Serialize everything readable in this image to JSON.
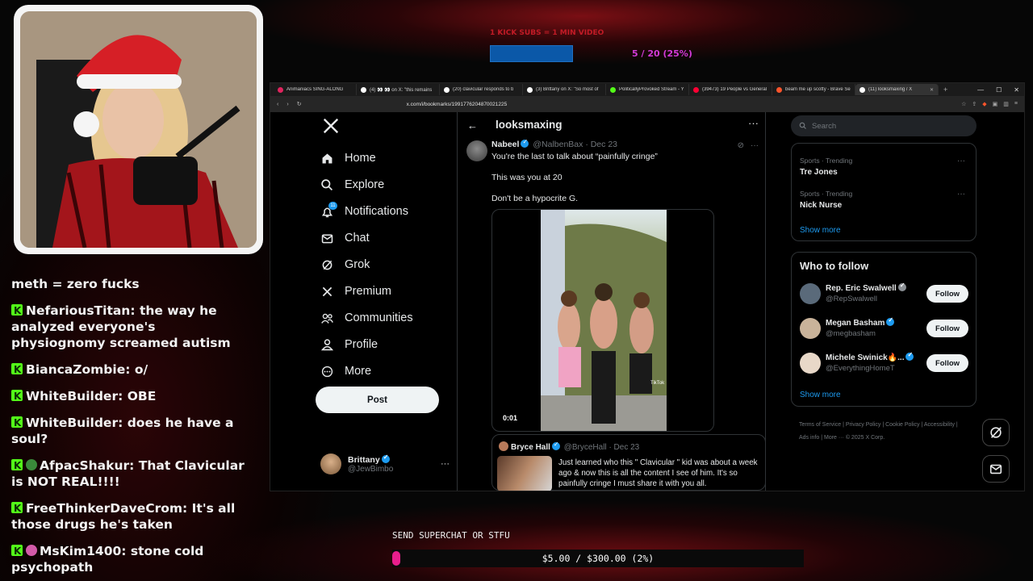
{
  "overlay_top": {
    "goal_label": "1 KICK SUBS = 1 MIN VIDEO",
    "goal_progress_text": "5 / 20 (25%)",
    "goal_progress_fraction": 0.25
  },
  "chat": {
    "messages": [
      {
        "user": "",
        "text": "meth = zero fucks",
        "badge": false,
        "emoji": ""
      },
      {
        "user": "NefariousTitan",
        "text": "the way he analyzed everyone's physiognomy screamed autism",
        "badge": true,
        "emoji": ""
      },
      {
        "user": "BiancaZombie",
        "text": "o/",
        "badge": true,
        "emoji": ""
      },
      {
        "user": "WhiteBuilder",
        "text": "OBE",
        "badge": true,
        "emoji": ""
      },
      {
        "user": "WhiteBuilder",
        "text": "does he have a soul?",
        "badge": true,
        "emoji": ""
      },
      {
        "user": "AfpacShakur",
        "text": "That Clavicular is NOT REAL!!!!",
        "badge": true,
        "emoji": "green"
      },
      {
        "user": "FreeThinkerDaveCrom",
        "text": "It's all those drugs he's taken",
        "badge": true,
        "emoji": ""
      },
      {
        "user": "MsKim1400",
        "text": "stone cold psychopath",
        "badge": true,
        "emoji": "pink"
      }
    ]
  },
  "browser": {
    "tabs": [
      {
        "title": "Animaniacs SING-ALONG",
        "color": "#e0245e",
        "active": false
      },
      {
        "title": "(4) 👀 👀 on X: \"this remains",
        "color": "#ffffff",
        "active": false
      },
      {
        "title": "(20) clavicular responds to b",
        "color": "#ffffff",
        "active": false
      },
      {
        "title": "(3) Brittany on X: \"So most of",
        "color": "#ffffff",
        "active": false
      },
      {
        "title": "PoliticallyProvoked Stream - Y",
        "color": "#53fc18",
        "active": false
      },
      {
        "title": "(39473) 19 People vs General",
        "color": "#ff0033",
        "active": false
      },
      {
        "title": "beam me up scotty - Brave Se",
        "color": "#fb542b",
        "active": false
      },
      {
        "title": "(11) looksmaxing / X",
        "color": "#ffffff",
        "active": true
      }
    ],
    "new_tab": "+",
    "url": "x.com/i/bookmarks/1991776204870021225"
  },
  "leftnav": {
    "items": [
      {
        "label": "Home",
        "icon": "home-icon"
      },
      {
        "label": "Explore",
        "icon": "search-icon"
      },
      {
        "label": "Notifications",
        "icon": "bell-icon"
      },
      {
        "label": "Chat",
        "icon": "mail-icon"
      },
      {
        "label": "Grok",
        "icon": "grok-icon"
      },
      {
        "label": "Premium",
        "icon": "x-icon"
      },
      {
        "label": "Communities",
        "icon": "people-icon"
      },
      {
        "label": "Profile",
        "icon": "person-icon"
      },
      {
        "label": "More",
        "icon": "more-circle-icon"
      }
    ],
    "notif_count": "11",
    "post_label": "Post",
    "me_name": "Brittany",
    "me_handle": "@JewBimbo",
    "me_more": "···"
  },
  "center": {
    "title": "looksmaxing",
    "back": "←",
    "more": "···",
    "tweet": {
      "name": "Nabeel",
      "handle": "@NalbenBax",
      "date": "· Dec 23",
      "line1": "You're the last to talk about “painfully cringe”",
      "line2": "This was you at 20",
      "line3": "Don't be a hypocrite G.",
      "video_time": "0:01",
      "video_watermark": "TikTok"
    },
    "quote": {
      "name": "Bryce Hall",
      "handle": "@BryceHall",
      "date": "· Dec 23",
      "text": "Just learned who this \" Clavicular \" kid was about a week ago & now this is all the content I see of him. It's so painfully cringe I must share it with you all."
    }
  },
  "right": {
    "search_placeholder": "Search",
    "trends": [
      {
        "meta": "Sports · Trending",
        "name": "Tre Jones"
      },
      {
        "meta": "Sports · Trending",
        "name": "Nick Nurse"
      }
    ],
    "show_more": "Show more",
    "wtf_title": "Who to follow",
    "follows": [
      {
        "name": "Rep. Eric Swalwell",
        "handle": "@RepSwalwell",
        "button": "Follow",
        "avatar": "#5a6a7a"
      },
      {
        "name": "Megan Basham",
        "handle": "@megbasham",
        "button": "Follow",
        "avatar": "#c9b39a"
      },
      {
        "name": "Michele Swinick🔥...",
        "handle": "@EverythingHomeT",
        "button": "Follow",
        "avatar": "#e8d8c8"
      }
    ],
    "footer": "Terms of Service | Privacy Policy | Cookie Policy | Accessibility | Ads info | More ··· © 2025 X Corp."
  },
  "overlay_bottom": {
    "superchat_label": "SEND SUPERCHAT OR STFU",
    "superchat_amount": "$5.00 / $300.00 (2%)",
    "superchat_fraction": 0.02
  }
}
